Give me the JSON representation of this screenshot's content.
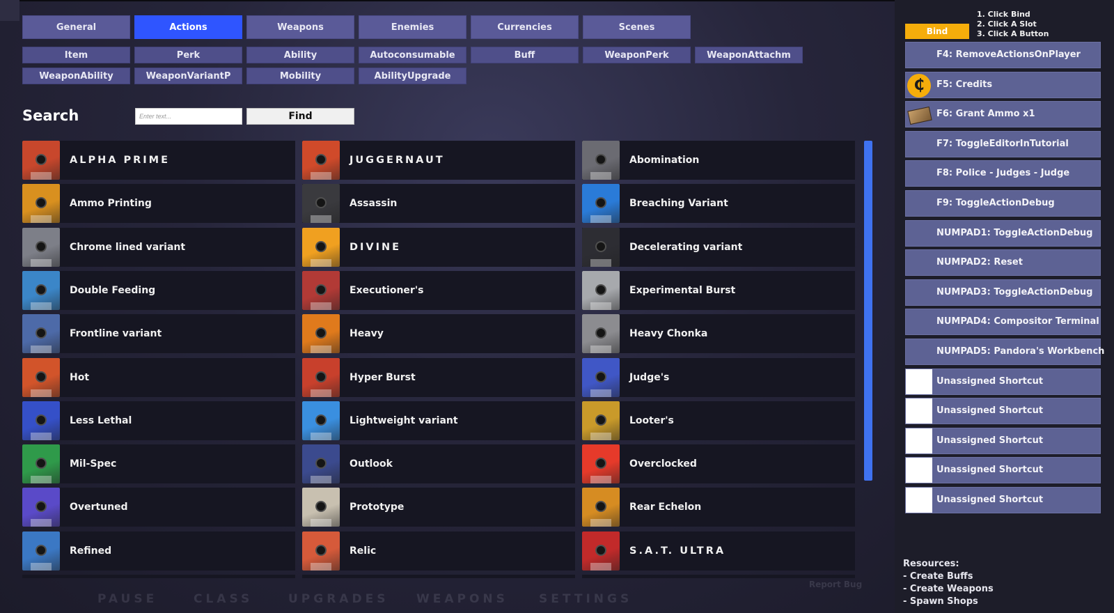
{
  "main_tabs": [
    {
      "label": "General",
      "active": false
    },
    {
      "label": "Actions",
      "active": true
    },
    {
      "label": "Weapons",
      "active": false
    },
    {
      "label": "Enemies",
      "active": false
    },
    {
      "label": "Currencies",
      "active": false
    },
    {
      "label": "Scenes",
      "active": false
    }
  ],
  "sub_tabs": [
    "Item",
    "Perk",
    "Ability",
    "Autoconsumable",
    "Buff",
    "WeaponPerk",
    "WeaponAttachm",
    "WeaponAbility",
    "WeaponVariantP",
    "Mobility",
    "AbilityUpgrade"
  ],
  "search": {
    "label": "Search",
    "placeholder": "Enter text...",
    "find_label": "Find"
  },
  "grid_items": [
    {
      "label": "ALPHA PRIME",
      "color": "#c8472c",
      "spaced": true
    },
    {
      "label": "JUGGERNAUT",
      "color": "#d04a2a",
      "spaced": true
    },
    {
      "label": "Abomination",
      "color": "#6b6b72"
    },
    {
      "label": "Ammo Printing",
      "color": "#d9901f"
    },
    {
      "label": "Assassin",
      "color": "#3a3a3e"
    },
    {
      "label": "Breaching Variant",
      "color": "#2a7bd8"
    },
    {
      "label": "Chrome lined variant",
      "color": "#7d7f88"
    },
    {
      "label": "DIVINE",
      "color": "#f0a020",
      "spaced": true
    },
    {
      "label": "Decelerating variant",
      "color": "#2d2d33"
    },
    {
      "label": "Double Feeding",
      "color": "#3b86c8"
    },
    {
      "label": "Executioner's",
      "color": "#b23a36"
    },
    {
      "label": "Experimental Burst",
      "color": "#a7a9ad"
    },
    {
      "label": "Frontline variant",
      "color": "#4d6aa8"
    },
    {
      "label": "Heavy",
      "color": "#e07a1c"
    },
    {
      "label": "Heavy Chonka",
      "color": "#8c8c90"
    },
    {
      "label": "Hot",
      "color": "#d2542a"
    },
    {
      "label": "Hyper Burst",
      "color": "#c8402c"
    },
    {
      "label": "Judge's",
      "color": "#4057c6"
    },
    {
      "label": "Less Lethal",
      "color": "#3550c8"
    },
    {
      "label": "Lightweight variant",
      "color": "#3a8fe0"
    },
    {
      "label": "Looter's",
      "color": "#c99a2a"
    },
    {
      "label": "Mil-Spec",
      "color": "#2f9a4a"
    },
    {
      "label": "Outlook",
      "color": "#3b4a8e"
    },
    {
      "label": "Overclocked",
      "color": "#e63a2a"
    },
    {
      "label": "Overtuned",
      "color": "#5a4ac8"
    },
    {
      "label": "Prototype",
      "color": "#c8c0b0"
    },
    {
      "label": "Rear Echelon",
      "color": "#d68c22"
    },
    {
      "label": "Refined",
      "color": "#3b78c4"
    },
    {
      "label": "Relic",
      "color": "#d65a3a"
    },
    {
      "label": "S.A.T. ULTRA",
      "color": "#c22a2a",
      "spaced": true
    }
  ],
  "panel": {
    "bind_label": "Bind",
    "instructions": [
      "1. Click Bind",
      "2. Click A Slot",
      "3. Click A Button"
    ],
    "slots": [
      {
        "label": "F4: RemoveActionsOnPlayer",
        "icon": "none"
      },
      {
        "label": "F5: Credits",
        "icon": "credits-coin-icon"
      },
      {
        "label": "F6: Grant Ammo x1",
        "icon": "ammo-box-icon"
      },
      {
        "label": "F7: ToggleEditorInTutorial",
        "icon": "none"
      },
      {
        "label": "F8: Police - Judges - Judge",
        "icon": "none"
      },
      {
        "label": "F9: ToggleActionDebug",
        "icon": "none"
      },
      {
        "label": "NUMPAD1: ToggleActionDebug",
        "icon": "none"
      },
      {
        "label": "NUMPAD2: Reset",
        "icon": "none"
      },
      {
        "label": "NUMPAD3: ToggleActionDebug",
        "icon": "none"
      },
      {
        "label": "NUMPAD4: Compositor Terminal",
        "icon": "none"
      },
      {
        "label": "NUMPAD5: Pandora's Workbench",
        "icon": "none"
      },
      {
        "label": "Unassigned Shortcut",
        "icon": "blank"
      },
      {
        "label": "Unassigned Shortcut",
        "icon": "blank"
      },
      {
        "label": "Unassigned Shortcut",
        "icon": "blank"
      },
      {
        "label": "Unassigned Shortcut",
        "icon": "blank"
      },
      {
        "label": "Unassigned Shortcut",
        "icon": "blank"
      }
    ],
    "resources_title": "Resources:",
    "resources": [
      "- Create Buffs",
      "- Create Weapons",
      "- Spawn Shops"
    ]
  },
  "background_nav": [
    "PAUSE",
    "CLASS",
    "UPGRADES",
    "WEAPONS",
    "SETTINGS"
  ],
  "report_bug_label": "Report Bug",
  "colors": {
    "active_tab": "#2f55ff",
    "tab": "#5a5a98",
    "bind": "#f5ad0b",
    "scrollbar": "#3f72f0",
    "slot": "#5d6294"
  }
}
